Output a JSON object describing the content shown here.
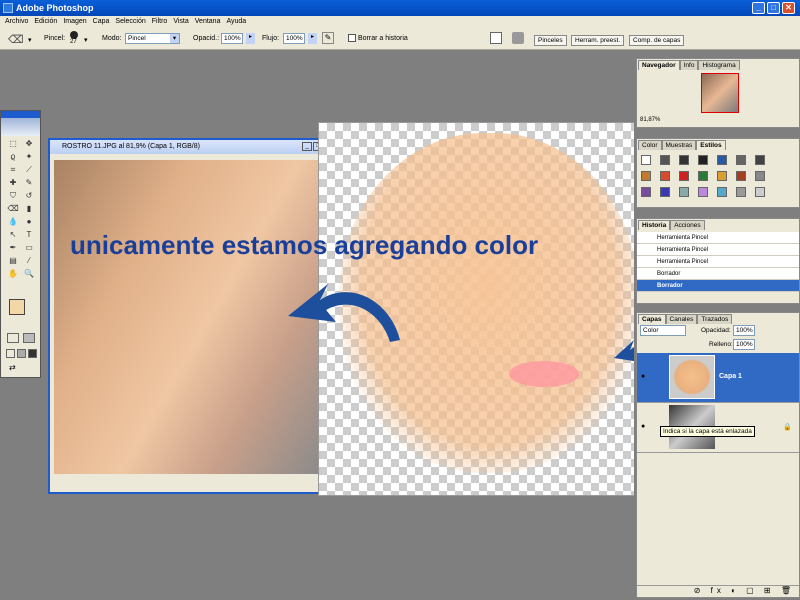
{
  "app": {
    "title": "Adobe Photoshop"
  },
  "menu": [
    "Archivo",
    "Edición",
    "Imagen",
    "Capa",
    "Selección",
    "Filtro",
    "Vista",
    "Ventana",
    "Ayuda"
  ],
  "options": {
    "brush_label": "Pincel:",
    "brush_size": "27",
    "mode_label": "Modo:",
    "mode_value": "Pincel",
    "opacity_label": "Opacid.:",
    "opacity_value": "100%",
    "flow_label": "Flujo:",
    "flow_value": "100%",
    "erase_history": "Borrar a historia"
  },
  "top_tabs": [
    "Pinceles",
    "Herram. preest.",
    "Comp. de capas"
  ],
  "document": {
    "title": "ROSTRO 11.JPG al 81,9% (Capa 1, RGB/8)"
  },
  "caption": "unicamente estamos agregando color",
  "navigator": {
    "tabs": [
      "Navegador",
      "Info",
      "Histograma"
    ],
    "zoom": "81,87%"
  },
  "styles_panel": {
    "tabs": [
      "Color",
      "Muestras",
      "Estilos"
    ]
  },
  "history": {
    "tabs": [
      "Historia",
      "Acciones"
    ],
    "items": [
      "Herramienta Pincel",
      "Herramienta Pincel",
      "Herramienta Pincel",
      "Borrador",
      "Borrador"
    ]
  },
  "layers": {
    "tabs": [
      "Capas",
      "Canales",
      "Trazados"
    ],
    "blend_mode": "Color",
    "opacity_label": "Opacidad:",
    "opacity_value": "100%",
    "fill_label": "Relleno:",
    "fill_value": "100%",
    "items": [
      "Capa 1"
    ],
    "tooltip": "Indica si la capa está enlazada"
  },
  "colors": {
    "accent": "#1e5bcf",
    "selected": "#316ac5",
    "caption": "#1a3f9a",
    "foreground_swatch": "#f3d7a6"
  }
}
